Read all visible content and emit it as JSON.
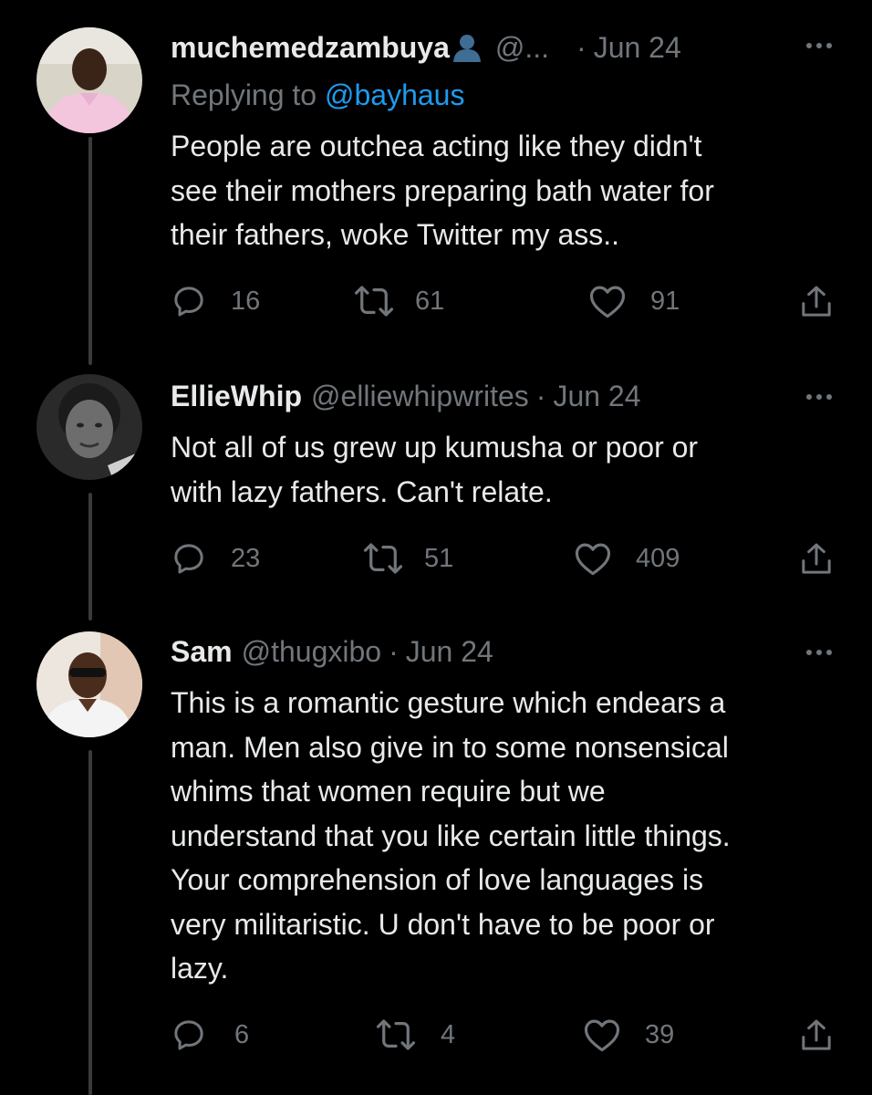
{
  "replies": [
    {
      "display_name": "muchemedzambuya",
      "has_verified_badge_emoji": true,
      "handle": "@...",
      "separator": "·",
      "date": "Jun 24",
      "replying_prefix": "Replying to",
      "replying_to": "@bayhaus",
      "text": "People are outchea acting like they didn't\nsee their mothers preparing bath water for\ntheir fathers, woke Twitter my ass..",
      "stats": {
        "replies": "16",
        "retweets": "61",
        "likes": "91"
      }
    },
    {
      "display_name": "EllieWhip",
      "handle": "@elliewhipwrites",
      "separator": "·",
      "date": "Jun 24",
      "text": "Not all of us grew up kumusha or poor or\nwith lazy fathers. Can't relate.",
      "stats": {
        "replies": "23",
        "retweets": "51",
        "likes": "409"
      }
    },
    {
      "display_name": "Sam",
      "handle": "@thugxibo",
      "separator": "·",
      "date": "Jun 24",
      "text": "This is a romantic gesture which endears a\nman. Men also give in to some nonsensical\nwhims that women require but we\nunderstand that you like certain little things.\nYour comprehension of love languages is\nvery militaristic. U don't have to be poor or\nlazy.",
      "stats": {
        "replies": "6",
        "retweets": "4",
        "likes": "39"
      }
    }
  ],
  "colors": {
    "background": "#000000",
    "text": "#e7e9ea",
    "muted": "#71767b",
    "link": "#1d9bf0",
    "thread_line": "#3a3a3a"
  },
  "icons": [
    "reply-icon",
    "retweet-icon",
    "like-icon",
    "share-icon",
    "more-icon",
    "bust-emoji-icon"
  ]
}
